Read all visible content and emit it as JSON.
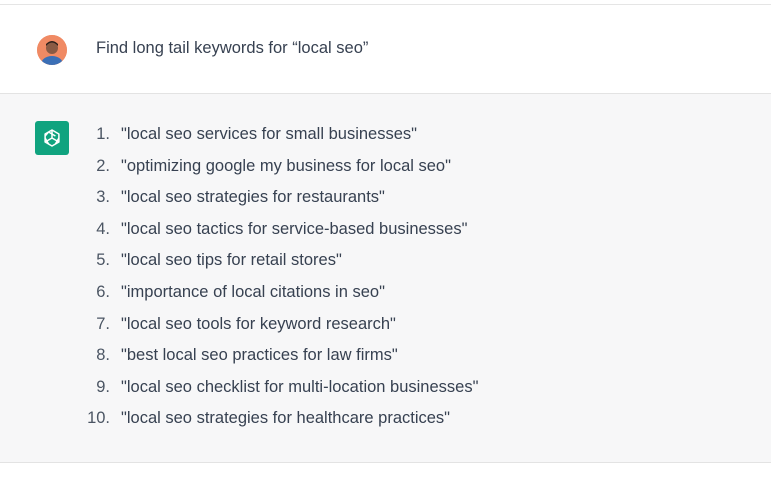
{
  "user_message": {
    "text": "Find long tail keywords for “local seo”"
  },
  "assistant_message": {
    "items": [
      {
        "num": "1.",
        "text": "\"local seo services for small businesses\""
      },
      {
        "num": "2.",
        "text": "\"optimizing google my business for local seo\""
      },
      {
        "num": "3.",
        "text": "\"local seo strategies for restaurants\""
      },
      {
        "num": "4.",
        "text": "\"local seo tactics for service-based businesses\""
      },
      {
        "num": "5.",
        "text": "\"local seo tips for retail stores\""
      },
      {
        "num": "6.",
        "text": "\"importance of local citations in seo\""
      },
      {
        "num": "7.",
        "text": "\"local seo tools for keyword research\""
      },
      {
        "num": "8.",
        "text": "\"best local seo practices for law firms\""
      },
      {
        "num": "9.",
        "text": "\"local seo checklist for multi-location businesses\""
      },
      {
        "num": "10.",
        "text": "\"local seo strategies for healthcare practices\""
      }
    ]
  },
  "icons": {
    "user_avatar": "avatar",
    "assistant_avatar": "openai-logo-icon"
  },
  "colors": {
    "assistant_icon_bg": "#10a37f",
    "assistant_row_bg": "#f7f7f8",
    "text": "#374151"
  }
}
